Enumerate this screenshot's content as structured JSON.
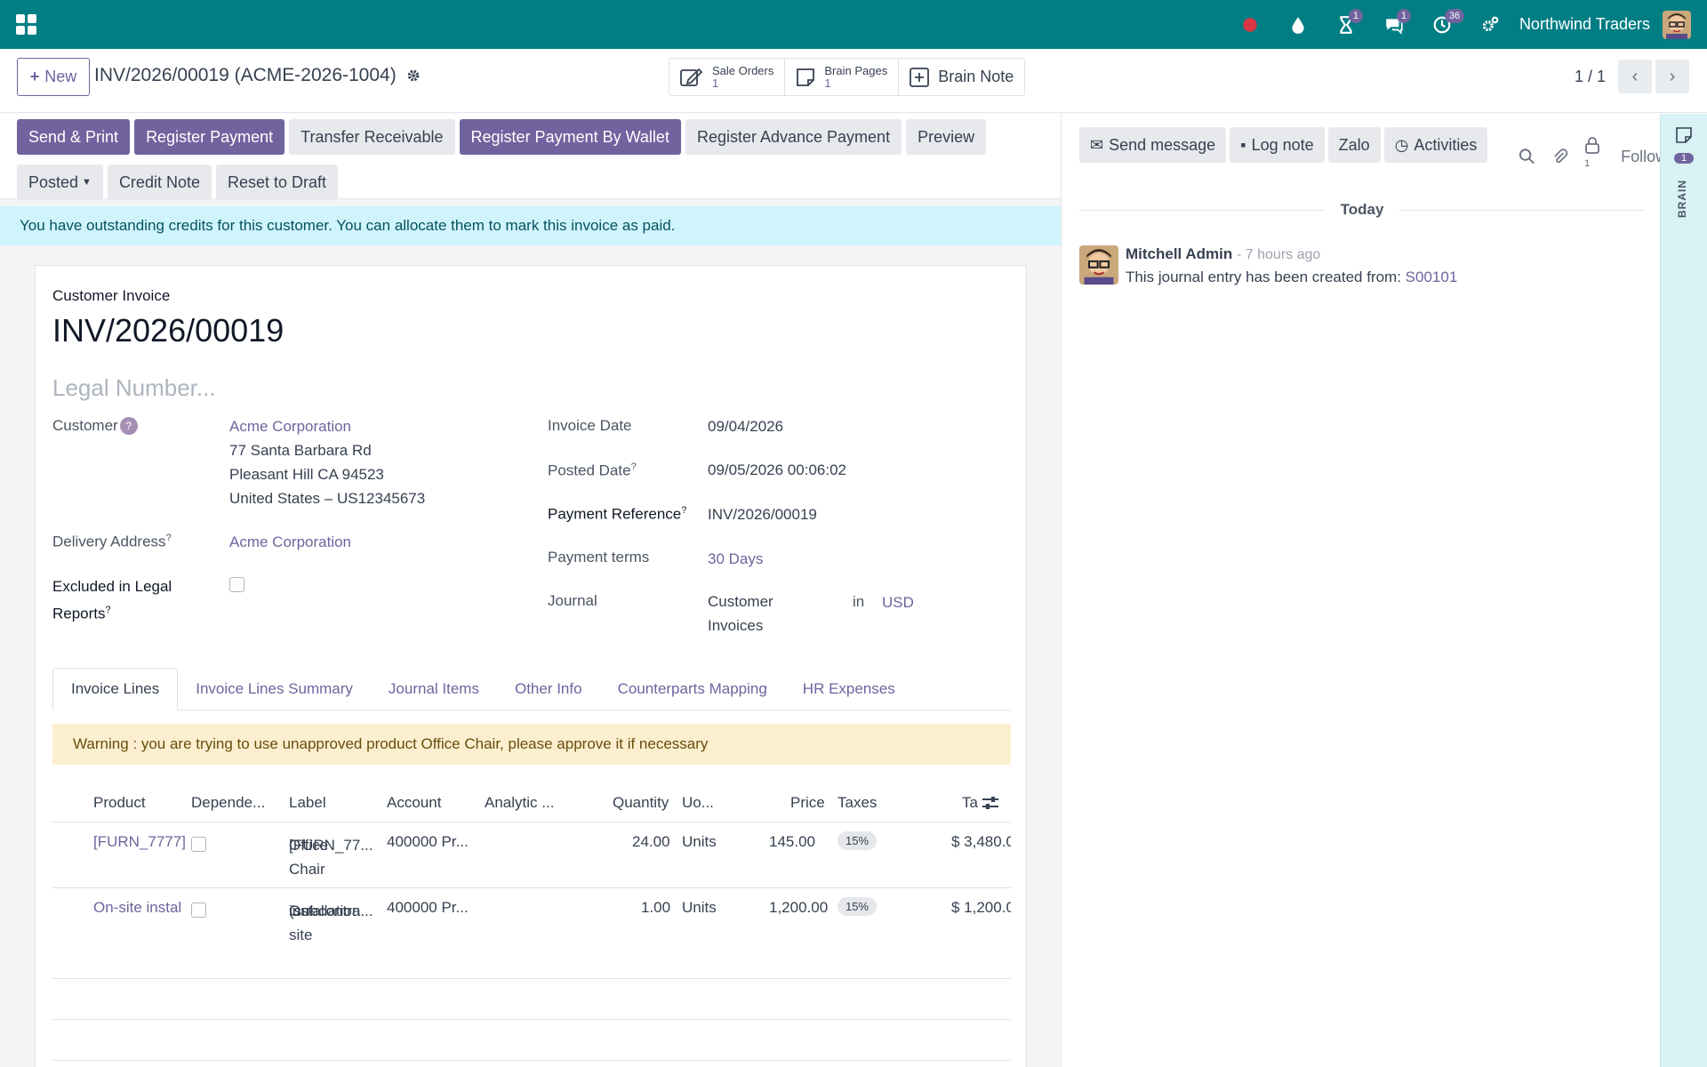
{
  "navbar": {
    "company": "Northwind Traders",
    "badges": {
      "activity": "1",
      "messages": "1",
      "clock": "36"
    },
    "colors": {
      "bg": "#017e84",
      "badge": "#71639e"
    }
  },
  "control": {
    "new_label": "New",
    "record_title": "INV/2026/00019 (ACME-2026-1004)",
    "smart_buttons": {
      "sale_orders": {
        "label": "Sale Orders",
        "value": "1"
      },
      "brain_pages": {
        "label": "Brain Pages",
        "value": "1"
      },
      "brain_note": {
        "label": "Brain Note"
      }
    },
    "pager": "1 / 1"
  },
  "actions": {
    "send_print": "Send & Print",
    "register_payment": "Register Payment",
    "transfer_receivable": "Transfer Receivable",
    "register_by_wallet": "Register Payment By Wallet",
    "register_advance": "Register Advance Payment",
    "preview": "Preview",
    "status": "Posted",
    "credit_note": "Credit Note",
    "reset_draft": "Reset to Draft"
  },
  "alert_info": "You have outstanding credits for this customer. You can allocate them to mark this invoice as paid.",
  "invoice": {
    "type": "Customer Invoice",
    "name": "INV/2026/00019",
    "legal_placeholder": "Legal Number...",
    "labels": {
      "customer": "Customer",
      "delivery": "Delivery Address",
      "excluded": "Excluded in Legal",
      "excluded2": "Reports",
      "invoice_date": "Invoice Date",
      "posted_date": "Posted Date",
      "payment_ref": "Payment Reference",
      "payment_terms": "Payment terms",
      "journal": "Journal",
      "in": "in"
    },
    "customer_name": "Acme Corporation",
    "address1": "77 Santa Barbara Rd",
    "address2": "Pleasant Hill CA 94523",
    "address3": "United States – US12345673",
    "delivery_name": "Acme Corporation",
    "invoice_date": "09/04/2026",
    "posted_date": "09/05/2026 00:06:02",
    "payment_ref": "INV/2026/00019",
    "payment_terms": "30 Days",
    "journal1": "Customer",
    "journal2": "Invoices",
    "currency": "USD"
  },
  "tabs": [
    "Invoice Lines",
    "Invoice Lines Summary",
    "Journal Items",
    "Other Info",
    "Counterparts Mapping",
    "HR Expenses"
  ],
  "warning": "Warning : you are trying to use unapproved product Office Chair, please approve it if necessary",
  "table": {
    "headers": [
      "Product",
      "Depende...",
      "Label",
      "Account",
      "Analytic ...",
      "Quantity",
      "Uo...",
      "Price",
      "Taxes",
      "Ta"
    ],
    "rows": [
      {
        "product": "[FURN_7777]",
        "label1": "[FURN_77...",
        "label2": "Office Chair",
        "label3": "",
        "account": "400000 Pr...",
        "qty": "24.00",
        "uom": "Units",
        "price": "145.00",
        "tax": "15%",
        "total": "$ 3,480.0"
      },
      {
        "product": "On-site instal",
        "label1": "On-site",
        "label2": "installation",
        "label3": "(subcontra...",
        "account": "400000 Pr...",
        "qty": "1.00",
        "uom": "Units",
        "price": "1,200.00",
        "tax": "15%",
        "total": "$ 1,200.0"
      }
    ]
  },
  "chatter": {
    "send_message": "Send message",
    "log_note": "Log note",
    "zalo": "Zalo",
    "activities": "Activities",
    "followers_count": "1",
    "follow": "Follow",
    "today": "Today",
    "author": "Mitchell Admin",
    "date": "- 7 hours ago",
    "body": "This journal entry has been created from:",
    "link": "S00101"
  },
  "brain": {
    "badge": "1",
    "label": "BRAIN"
  }
}
